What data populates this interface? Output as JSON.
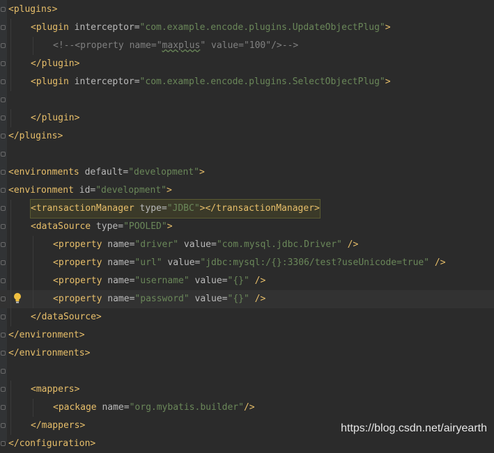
{
  "lines": [
    {
      "indent": 0,
      "segments": [
        {
          "t": "<plugins>",
          "c": "t"
        }
      ]
    },
    {
      "indent": 1,
      "segments": [
        {
          "t": "<plugin ",
          "c": "t"
        },
        {
          "t": "interceptor",
          "c": "a"
        },
        {
          "t": "=",
          "c": "a"
        },
        {
          "t": "\"com.example.encode.plugins.UpdateObjectPlug\"",
          "c": "v"
        },
        {
          "t": ">",
          "c": "t"
        }
      ]
    },
    {
      "indent": 2,
      "segments": [
        {
          "t": "<!--<property name=\"",
          "c": "c"
        },
        {
          "t": "maxplus",
          "c": "cv"
        },
        {
          "t": "\" value=\"100\"/>-->",
          "c": "c"
        }
      ]
    },
    {
      "indent": 1,
      "segments": [
        {
          "t": "</plugin>",
          "c": "t"
        }
      ]
    },
    {
      "indent": 1,
      "segments": [
        {
          "t": "<plugin ",
          "c": "t"
        },
        {
          "t": "interceptor",
          "c": "a"
        },
        {
          "t": "=",
          "c": "a"
        },
        {
          "t": "\"com.example.encode.plugins.SelectObjectPlug\"",
          "c": "v"
        },
        {
          "t": ">",
          "c": "t"
        }
      ]
    },
    {
      "indent": 0,
      "segments": []
    },
    {
      "indent": 1,
      "segments": [
        {
          "t": "</plugin>",
          "c": "t"
        }
      ]
    },
    {
      "indent": 0,
      "segments": [
        {
          "t": "</plugins>",
          "c": "t"
        }
      ]
    },
    {
      "indent": 0,
      "segments": []
    },
    {
      "indent": 0,
      "segments": [
        {
          "t": "<environments ",
          "c": "t"
        },
        {
          "t": "default",
          "c": "a"
        },
        {
          "t": "=",
          "c": "a"
        },
        {
          "t": "\"development\"",
          "c": "v"
        },
        {
          "t": ">",
          "c": "t"
        }
      ]
    },
    {
      "indent": 0,
      "segments": [
        {
          "t": "<environment ",
          "c": "t"
        },
        {
          "t": "id",
          "c": "a"
        },
        {
          "t": "=",
          "c": "a"
        },
        {
          "t": "\"development\"",
          "c": "v"
        },
        {
          "t": ">",
          "c": "t"
        }
      ]
    },
    {
      "indent": 1,
      "boxed": true,
      "segments": [
        {
          "t": "<transactionManager ",
          "c": "t"
        },
        {
          "t": "type",
          "c": "a"
        },
        {
          "t": "=",
          "c": "a"
        },
        {
          "t": "\"JDBC\"",
          "c": "v"
        },
        {
          "t": "></transactionManager>",
          "c": "t"
        }
      ]
    },
    {
      "indent": 1,
      "segments": [
        {
          "t": "<dataSource ",
          "c": "t"
        },
        {
          "t": "type",
          "c": "a"
        },
        {
          "t": "=",
          "c": "a"
        },
        {
          "t": "\"POOLED\"",
          "c": "v"
        },
        {
          "t": ">",
          "c": "t"
        }
      ]
    },
    {
      "indent": 2,
      "segments": [
        {
          "t": "<property ",
          "c": "t"
        },
        {
          "t": "name",
          "c": "a"
        },
        {
          "t": "=",
          "c": "a"
        },
        {
          "t": "\"driver\"",
          "c": "v"
        },
        {
          "t": " value",
          "c": "a"
        },
        {
          "t": "=",
          "c": "a"
        },
        {
          "t": "\"com.mysql.jdbc.Driver\"",
          "c": "v"
        },
        {
          "t": " />",
          "c": "t"
        }
      ]
    },
    {
      "indent": 2,
      "segments": [
        {
          "t": "<property ",
          "c": "t"
        },
        {
          "t": "name",
          "c": "a"
        },
        {
          "t": "=",
          "c": "a"
        },
        {
          "t": "\"url\"",
          "c": "v"
        },
        {
          "t": " value",
          "c": "a"
        },
        {
          "t": "=",
          "c": "a"
        },
        {
          "t": "\"jdbc:mysql:/{}:3306/test?useUnicode=true\"",
          "c": "v"
        },
        {
          "t": " />",
          "c": "t"
        }
      ]
    },
    {
      "indent": 2,
      "segments": [
        {
          "t": "<property ",
          "c": "t"
        },
        {
          "t": "name",
          "c": "a"
        },
        {
          "t": "=",
          "c": "a"
        },
        {
          "t": "\"username\"",
          "c": "v"
        },
        {
          "t": " value",
          "c": "a"
        },
        {
          "t": "=",
          "c": "a"
        },
        {
          "t": "\"{}\"",
          "c": "v"
        },
        {
          "t": " />",
          "c": "t"
        }
      ]
    },
    {
      "indent": 2,
      "highlight": true,
      "bulb": true,
      "segments": [
        {
          "t": "<property ",
          "c": "t"
        },
        {
          "t": "name",
          "c": "a"
        },
        {
          "t": "=",
          "c": "a"
        },
        {
          "t": "\"password\"",
          "c": "v"
        },
        {
          "t": " value",
          "c": "a"
        },
        {
          "t": "=",
          "c": "a"
        },
        {
          "t": "\"{}\"",
          "c": "v"
        },
        {
          "t": " />",
          "c": "t"
        }
      ]
    },
    {
      "indent": 1,
      "segments": [
        {
          "t": "</dataSource>",
          "c": "t"
        }
      ]
    },
    {
      "indent": 0,
      "segments": [
        {
          "t": "</environment>",
          "c": "t"
        }
      ]
    },
    {
      "indent": 0,
      "segments": [
        {
          "t": "</environments>",
          "c": "t"
        }
      ]
    },
    {
      "indent": 0,
      "segments": []
    },
    {
      "indent": 1,
      "segments": [
        {
          "t": "<mappers>",
          "c": "t"
        }
      ]
    },
    {
      "indent": 2,
      "segments": [
        {
          "t": "<package ",
          "c": "t"
        },
        {
          "t": "name",
          "c": "a"
        },
        {
          "t": "=",
          "c": "a"
        },
        {
          "t": "\"org.mybatis.builder\"",
          "c": "v"
        },
        {
          "t": "/>",
          "c": "t"
        }
      ]
    },
    {
      "indent": 1,
      "segments": [
        {
          "t": "</mappers>",
          "c": "t"
        }
      ]
    },
    {
      "indent": 0,
      "segments": [
        {
          "t": "</configuration>",
          "c": "t"
        }
      ]
    }
  ],
  "watermark": "https://blog.csdn.net/airyearth",
  "colors": {
    "background": "#2b2b2b",
    "tag": "#e8bf6a",
    "attribute": "#bababa",
    "value": "#6a8759",
    "comment": "#808080"
  },
  "icons": {
    "intention_bulb": "lightbulb-icon",
    "fold_marker": "fold-marker-icon"
  }
}
